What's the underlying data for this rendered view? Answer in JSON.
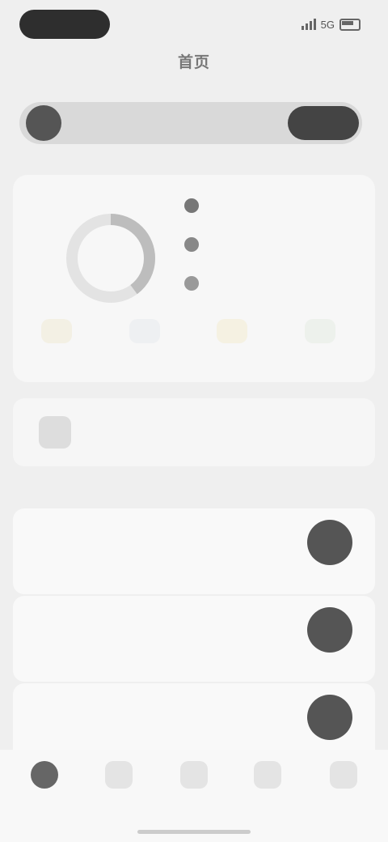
{
  "status_bar": {
    "time": "",
    "network": "5G"
  },
  "header": {
    "title": "首页"
  },
  "search": {
    "placeholder": "",
    "button_label": ""
  },
  "summary": {
    "top_link": "",
    "corner_text": "",
    "total_value": "",
    "total_caption": "",
    "legend": [
      {
        "label": "",
        "value": "",
        "color": "#777777"
      },
      {
        "label": "",
        "value": "",
        "color": "#888888"
      },
      {
        "label": "",
        "value": "",
        "color": "#999999"
      }
    ],
    "quick_actions": [
      {
        "label": "",
        "color": "#f3f0e4"
      },
      {
        "label": "",
        "color": "#eef0f2"
      },
      {
        "label": "",
        "color": "#f5f1e2"
      },
      {
        "label": "",
        "color": "#edf1ec"
      }
    ]
  },
  "banner": {
    "title": ""
  },
  "section": {
    "title": ""
  },
  "list": [
    {
      "label": ""
    },
    {
      "label": ""
    },
    {
      "label": ""
    }
  ],
  "bottom_nav": [
    {
      "label": "",
      "active": true
    },
    {
      "label": "",
      "active": false
    },
    {
      "label": "",
      "active": false
    },
    {
      "label": "",
      "active": false
    },
    {
      "label": "",
      "active": false
    }
  ]
}
